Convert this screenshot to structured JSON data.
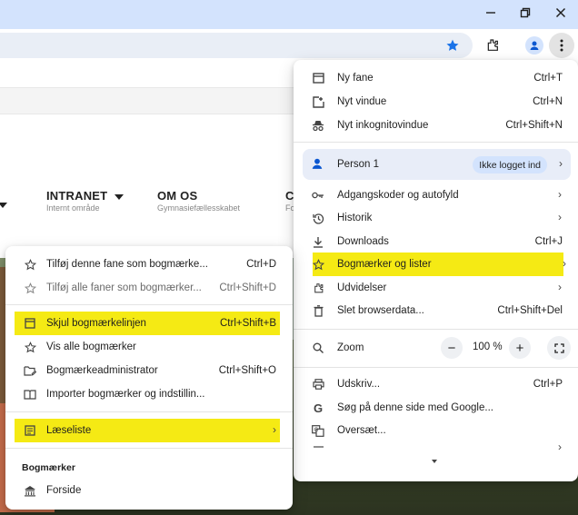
{
  "window": {
    "minimize_icon": "minimize-icon",
    "restore_icon": "restore-icon",
    "close_icon": "close-icon"
  },
  "toolbar": {
    "bookmark_icon": "star-filled-icon",
    "extensions_icon": "puzzle-icon",
    "profile_icon": "person-icon",
    "menu_icon": "three-dots-icon",
    "accent": "#1a73e8"
  },
  "page": {
    "nav": [
      {
        "title": "INTRANET",
        "subtitle": "Internt område"
      },
      {
        "title": "OM OS",
        "subtitle": "Gymnasiefællesskabet"
      },
      {
        "title": "C",
        "subtitle": "Fo"
      }
    ]
  },
  "chrome_menu": {
    "items_top": [
      {
        "icon": "new-tab-icon",
        "label": "Ny fane",
        "shortcut": "Ctrl+T"
      },
      {
        "icon": "new-window-icon",
        "label": "Nyt vindue",
        "shortcut": "Ctrl+N"
      },
      {
        "icon": "incognito-icon",
        "label": "Nyt inkognitovindue",
        "shortcut": "Ctrl+Shift+N"
      }
    ],
    "person": {
      "label": "Person 1",
      "badge": "Ikke logget ind"
    },
    "items_mid": [
      {
        "icon": "key-icon",
        "label": "Adgangskoder og autofyld",
        "shortcut": ""
      },
      {
        "icon": "history-icon",
        "label": "Historik",
        "shortcut": ""
      },
      {
        "icon": "download-icon",
        "label": "Downloads",
        "shortcut": "Ctrl+J"
      },
      {
        "icon": "star-icon",
        "label": "Bogmærker og lister",
        "shortcut": ""
      },
      {
        "icon": "puzzle-icon",
        "label": "Udvidelser",
        "shortcut": ""
      },
      {
        "icon": "trash-icon",
        "label": "Slet browserdata...",
        "shortcut": "Ctrl+Shift+Del"
      }
    ],
    "zoom": {
      "label": "Zoom",
      "minus": "−",
      "value": "100 %",
      "plus": "+"
    },
    "items_bottom": [
      {
        "icon": "print-icon",
        "label": "Udskriv...",
        "shortcut": "Ctrl+P"
      },
      {
        "icon": "google-icon",
        "label": "Søg på denne side med Google...",
        "shortcut": ""
      },
      {
        "icon": "translate-icon",
        "label": "Oversæt...",
        "shortcut": ""
      }
    ],
    "highlight_color": "#f5ea14"
  },
  "bookmarks_menu": {
    "items_top": [
      {
        "icon": "star-outline-icon",
        "label": "Tilføj denne fane som bogmærke...",
        "shortcut": "Ctrl+D"
      },
      {
        "icon": "star-outline-icon",
        "label": "Tilføj alle faner som bogmærker...",
        "shortcut": "Ctrl+Shift+D"
      }
    ],
    "items_mid": [
      {
        "icon": "bookmark-bar-icon",
        "label": "Skjul bogmærkelinjen",
        "shortcut": "Ctrl+Shift+B"
      },
      {
        "icon": "star-outline-icon",
        "label": "Vis alle bogmærker",
        "shortcut": ""
      },
      {
        "icon": "folder-edit-icon",
        "label": "Bogmærkeadministrator",
        "shortcut": "Ctrl+Shift+O"
      },
      {
        "icon": "import-icon",
        "label": "Importer bogmærker og indstillin...",
        "shortcut": ""
      }
    ],
    "reading_list": {
      "icon": "reading-list-icon",
      "label": "Læseliste"
    },
    "section_label": "Bogmærker",
    "bookmark": {
      "icon": "site-favicon-icon",
      "label": "Forside"
    }
  }
}
